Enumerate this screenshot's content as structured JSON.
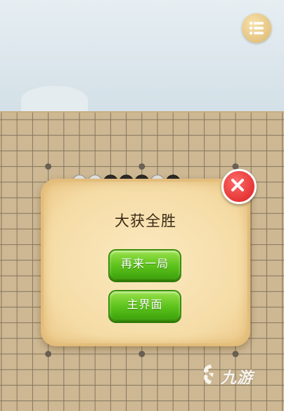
{
  "dialog": {
    "title": "大获全胜",
    "play_again_label": "再来一局",
    "main_menu_label": "主界面"
  },
  "header": {
    "menu_icon": "list-menu-icon"
  },
  "watermark": {
    "text": "九游",
    "logo_icon": "jiuyou-logo-icon"
  },
  "board": {
    "stones": [
      {
        "color": "white",
        "col": 5,
        "row": 4
      },
      {
        "color": "white",
        "col": 6,
        "row": 4
      },
      {
        "color": "black",
        "col": 7,
        "row": 4
      },
      {
        "color": "black",
        "col": 8,
        "row": 4
      },
      {
        "color": "black",
        "col": 9,
        "row": 4
      },
      {
        "color": "white",
        "col": 10,
        "row": 4
      },
      {
        "color": "black",
        "col": 11,
        "row": 4
      }
    ]
  },
  "colors": {
    "board": "#d9c39d",
    "grid_line": "#8a7a63",
    "button_green": "#5cc21b",
    "close_red": "#d91f1f",
    "dialog_bg": "#f5dca6"
  }
}
